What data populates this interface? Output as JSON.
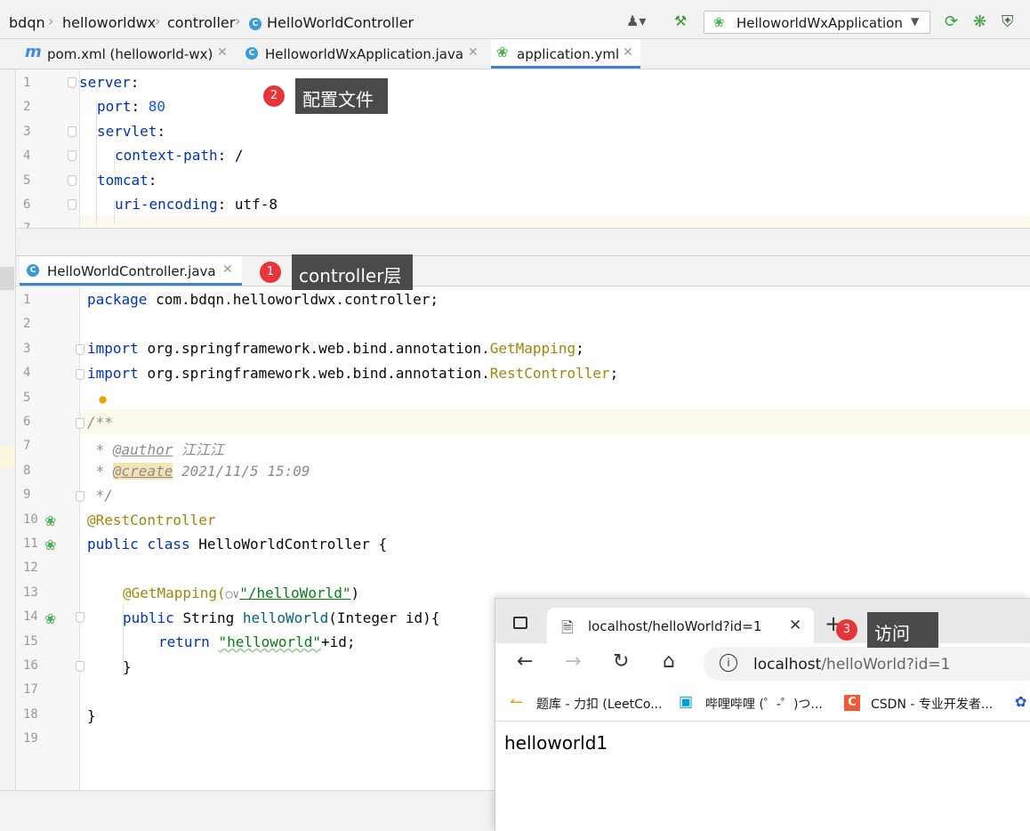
{
  "breadcrumb": [
    "bdqn",
    "helloworldwx",
    "controller",
    "HelloWorldController"
  ],
  "run_config": {
    "label": "HelloworldWxApplication"
  },
  "top_tabs": [
    {
      "label": "pom.xml (helloworld-wx)",
      "icon": "maven-icon"
    },
    {
      "label": "HelloworldWxApplication.java",
      "icon": "spring-class-icon"
    },
    {
      "label": "application.yml",
      "icon": "yaml-icon",
      "active": true
    }
  ],
  "yaml_lines": [
    {
      "n": "1"
    },
    {
      "n": "2"
    },
    {
      "n": "3"
    },
    {
      "n": "4"
    },
    {
      "n": "5"
    },
    {
      "n": "6"
    },
    {
      "n": "7"
    }
  ],
  "yaml": {
    "server": "server",
    "port_key": "port",
    "port_val": "80",
    "servlet": "servlet",
    "context_path_key": "context-path",
    "context_path_val": "/",
    "tomcat": "tomcat",
    "uri_key": "uri-encoding",
    "uri_val": "utf-8"
  },
  "bottom_tab": {
    "label": "HelloWorldController.java"
  },
  "java_lines": [
    "1",
    "2",
    "3",
    "4",
    "5",
    "6",
    "7",
    "8",
    "9",
    "10",
    "11",
    "12",
    "13",
    "14",
    "15",
    "16",
    "17",
    "18",
    "19"
  ],
  "java": {
    "package": "package",
    "package_name": "com.bdqn.helloworldwx.controller;",
    "import": "import",
    "import1_path": "org.springframework.web.bind.annotation.",
    "import1_cls": "GetMapping",
    "import2_path": "org.springframework.web.bind.annotation.",
    "import2_cls": "RestController",
    "doc_open": "/**",
    "author_tag": "@author",
    "author_val": "江江江",
    "create_tag": "@create",
    "create_val": "2021/11/5 15:09",
    "doc_close": "*/",
    "rest_ann": "@RestController",
    "public": "public",
    "class": "class",
    "class_name": "HelloWorldController {",
    "get_ann": "@GetMapping(",
    "get_path": "\"/helloWorld\"",
    "get_close": ")",
    "string": "String",
    "method": "helloWorld",
    "params": "(Integer id){",
    "return": "return",
    "ret_str": "\"helloworld\"",
    "ret_rest": "+id;",
    "close1": "}",
    "close2": "}"
  },
  "callouts": [
    {
      "badge": "2",
      "text": "配置文件"
    },
    {
      "badge": "1",
      "text": "controller层"
    },
    {
      "badge": "3",
      "text": "访问"
    }
  ],
  "browser": {
    "tab_title": "localhost/helloWorld?id=1",
    "url_host": "localhost",
    "url_path": "/helloWorld?id=1",
    "bookmarks": [
      "题库 - 力扣 (LeetCo...",
      "哔哩哔哩 (゜-゜)つ...",
      "CSDN - 专业开发者..."
    ],
    "content": "helloworld1"
  }
}
